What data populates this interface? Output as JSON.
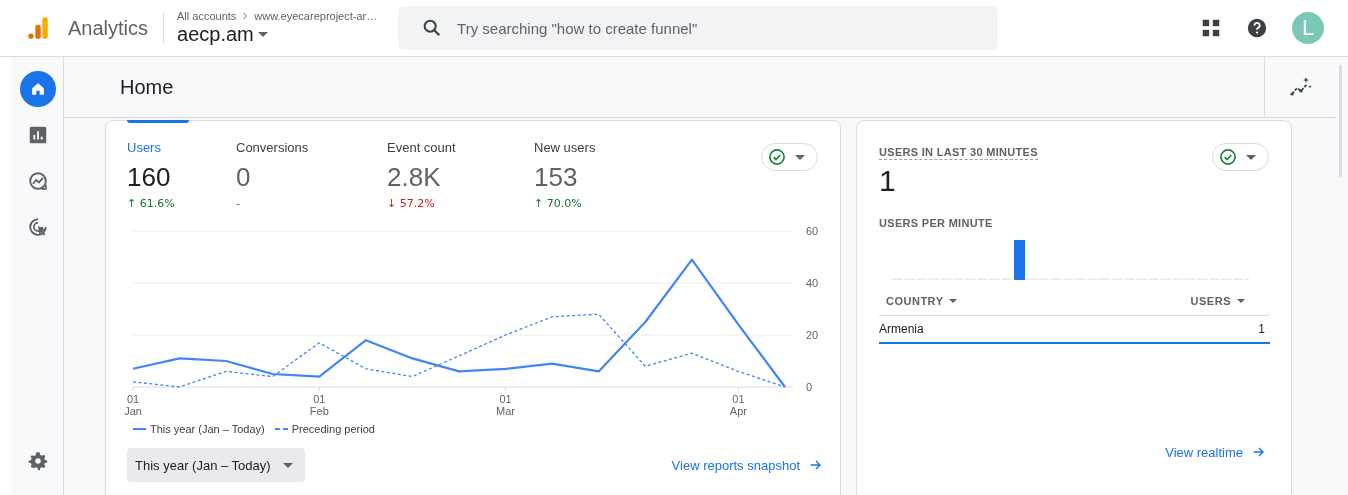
{
  "app": {
    "name": "Analytics",
    "breadcrumb": [
      "All accounts",
      "www.eyecareproject-ar…"
    ],
    "property": "aecp.am"
  },
  "search": {
    "placeholder": "Try searching \"how to create funnel\""
  },
  "avatar": {
    "initial": "L"
  },
  "nav": [
    {
      "kind": "home",
      "selected": true
    },
    {
      "kind": "reports",
      "selected": false
    },
    {
      "kind": "explore",
      "selected": false
    },
    {
      "kind": "advertising",
      "selected": false
    },
    {
      "kind": "settings",
      "selected": false
    }
  ],
  "page": {
    "title": "Home"
  },
  "overview": {
    "metrics": [
      {
        "label": "Users",
        "value": "160",
        "change": "↑ 61.6%",
        "color": "#137333",
        "selected": true
      },
      {
        "label": "Conversions",
        "value": "0",
        "change": "-",
        "selected": false
      },
      {
        "label": "Event count",
        "value": "2.8K",
        "change": "↓ 57.2%",
        "color": "#c5221f",
        "selected": false
      },
      {
        "label": "New users",
        "value": "153",
        "change": "↑ 70.0%",
        "color": "#137333",
        "selected": false
      }
    ],
    "chart_data": {
      "type": "line",
      "categories": [
        "01 Jan",
        null,
        null,
        null,
        "01 Feb",
        null,
        null,
        null,
        "01 Mar",
        null,
        null,
        null,
        null,
        "01 Apr",
        null
      ],
      "series": [
        {
          "name": "This year (Jan – Today)",
          "color": "#4285f4",
          "line_style": "solid",
          "values": [
            7,
            11,
            10,
            5,
            4,
            18,
            11,
            6,
            7,
            9,
            6,
            25,
            49,
            24,
            0
          ]
        },
        {
          "name": "Preceding period",
          "color": "#4285f4",
          "line_style": "dashed",
          "values": [
            2,
            0,
            6,
            4,
            17,
            7,
            4,
            12,
            20,
            27,
            28,
            8,
            13,
            6,
            0
          ]
        }
      ],
      "ylim": [
        0,
        60
      ],
      "yticks": [
        0,
        20,
        40,
        60
      ]
    },
    "date_range": "This year (Jan – Today)",
    "link": "View reports snapshot"
  },
  "realtime": {
    "title": "USERS IN LAST 30 MINUTES",
    "value": "1",
    "subtitle": "USERS PER MINUTE",
    "columns": [
      "COUNTRY",
      "USERS"
    ],
    "rows": [
      {
        "country": "Armenia",
        "users": "1",
        "level": 1
      }
    ],
    "link": "View realtime"
  }
}
